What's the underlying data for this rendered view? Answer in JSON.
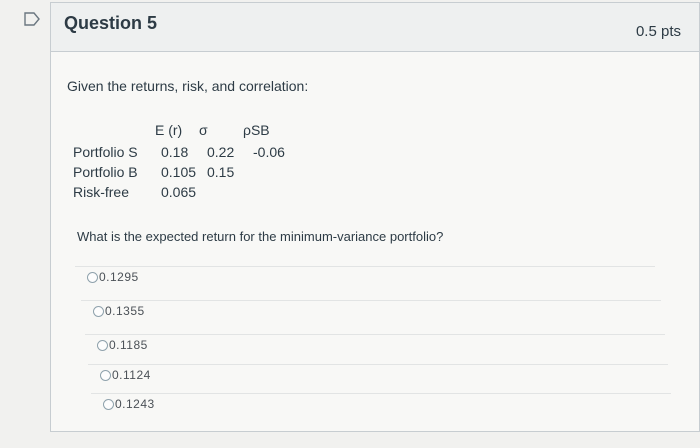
{
  "header": {
    "title": "Question 5",
    "points": "0.5 pts"
  },
  "prompt": "Given the returns, risk, and correlation:",
  "table": {
    "headers": {
      "er": "E (r)",
      "sigma": "σ",
      "rho": "ρSB"
    },
    "rows": [
      {
        "name": "Portfolio S",
        "er": "0.18",
        "sigma": "0.22",
        "rho": "-0.06"
      },
      {
        "name": "Portfolio B",
        "er": "0.105",
        "sigma": "0.15",
        "rho": ""
      },
      {
        "name": "Risk-free",
        "er": "0.065",
        "sigma": "",
        "rho": ""
      }
    ]
  },
  "question": "What is the expected return for the minimum-variance portfolio?",
  "answers": [
    "0.1295",
    "0.1355",
    "0.1185",
    "0.1124",
    "0.1243"
  ]
}
